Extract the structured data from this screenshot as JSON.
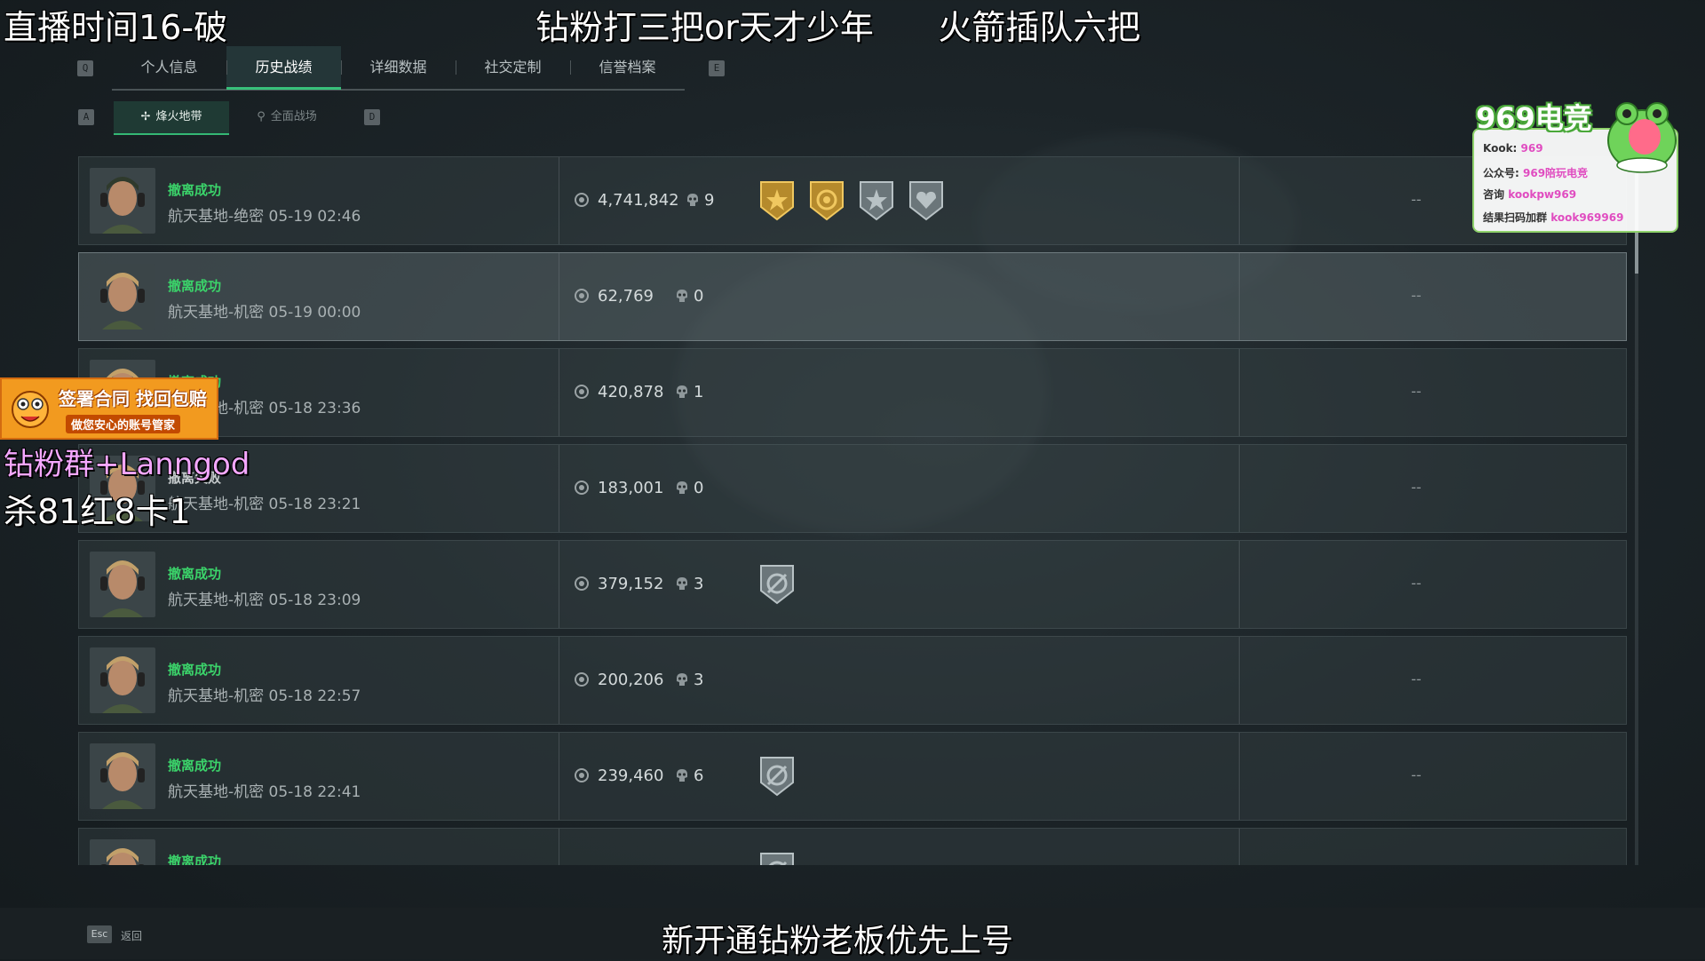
{
  "overlay": {
    "top_left": "直播时间16-破",
    "top_center": "钻粉打三把or天才少年      火箭插队六把",
    "left_pink": "钻粉群+Lanngod",
    "left_kills": "杀81红8卡1",
    "ad_line1": "签署合同 找回包赔",
    "ad_line2": "做您安心的账号管家",
    "bottom": "新开通钻粉老板优先上号"
  },
  "sponsor": {
    "title": "969电竞",
    "line1_label": "Kook:",
    "line1_value": "969",
    "line2_label": "公众号:",
    "line2_value": "969陪玩电竞",
    "line3_label": "咨询",
    "line3_value": "kookpw969",
    "line4_label": "结果扫码加群",
    "line4_value": "kook969969"
  },
  "tabs": {
    "left_key": "Q",
    "right_key": "E",
    "items": [
      "个人信息",
      "历史战绩",
      "详细数据",
      "社交定制",
      "信誉档案"
    ],
    "active_index": 1
  },
  "subtabs": {
    "left_key": "A",
    "right_key": "D",
    "items": [
      "烽火地带",
      "全面战场"
    ],
    "active_index": 0
  },
  "matches": [
    {
      "status": "撤离成功",
      "map": "航天基地-绝密 05-19 02:46",
      "value": "4,741,842",
      "kills": "9",
      "badges": [
        "gold-star-badge",
        "gold-target-badge",
        "silver-star-badge",
        "silver-heart-badge"
      ],
      "extra": "--"
    },
    {
      "status": "撤离成功",
      "map": "航天基地-机密 05-19 00:00",
      "value": "62,769",
      "kills": "0",
      "badges": [],
      "extra": "--"
    },
    {
      "status": "撤离成功",
      "map": "航天基地-机密 05-18 23:36",
      "value": "420,878",
      "kills": "1",
      "badges": [],
      "extra": "--"
    },
    {
      "status": "撤离失败",
      "map": "航天基地-机密 05-18 23:21",
      "value": "183,001",
      "kills": "0",
      "badges": [],
      "extra": "--"
    },
    {
      "status": "撤离成功",
      "map": "航天基地-机密 05-18 23:09",
      "value": "379,152",
      "kills": "3",
      "badges": [
        "silver-crosshair-badge"
      ],
      "extra": "--"
    },
    {
      "status": "撤离成功",
      "map": "航天基地-机密 05-18 22:57",
      "value": "200,206",
      "kills": "3",
      "badges": [],
      "extra": "--"
    },
    {
      "status": "撤离成功",
      "map": "航天基地-机密 05-18 22:41",
      "value": "239,460",
      "kills": "6",
      "badges": [
        "silver-crosshair-badge"
      ],
      "extra": "--"
    },
    {
      "status": "撤离成功",
      "map": "",
      "value": "",
      "kills": "",
      "badges": [
        "silver-crosshair-badge"
      ],
      "extra": ""
    }
  ],
  "footer": {
    "esc_key": "Esc",
    "back_label": "返回"
  },
  "colors": {
    "success": "#3bd36a",
    "accent_tab": "#38c07a",
    "sponsor_green": "#4aa83a",
    "ad_orange": "#f29a1f"
  }
}
